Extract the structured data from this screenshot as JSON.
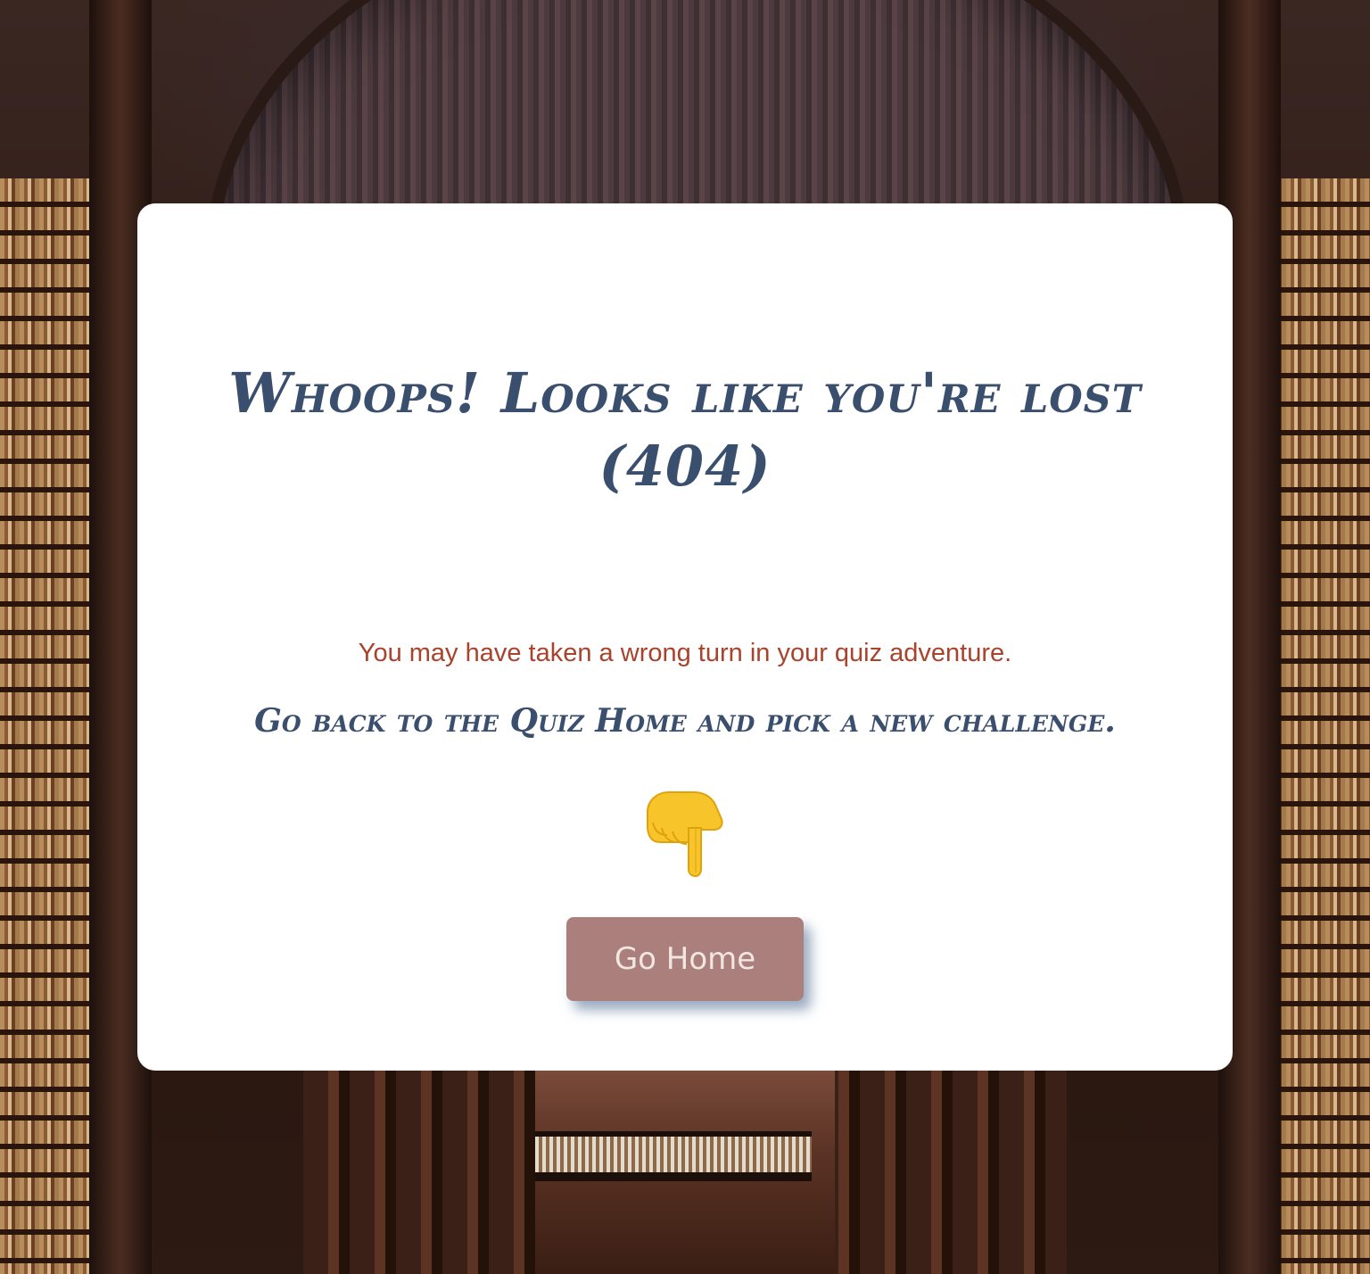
{
  "page": {
    "title": "Whoops! Looks like you're lost (404)",
    "message": "You may have taken a wrong turn in your quiz adventure.",
    "call_to_action": "Go back to the Quiz Home and pick a new challenge.",
    "pointer_icon": "backhand-index-pointing-down-icon",
    "button_label": "Go Home"
  },
  "colors": {
    "title": "#3a4e6e",
    "message": "#a9432c",
    "button_bg": "#ab807c",
    "button_text": "#f1e6e0",
    "card_bg": "#ffffff",
    "pointer": "#f7c52a"
  }
}
